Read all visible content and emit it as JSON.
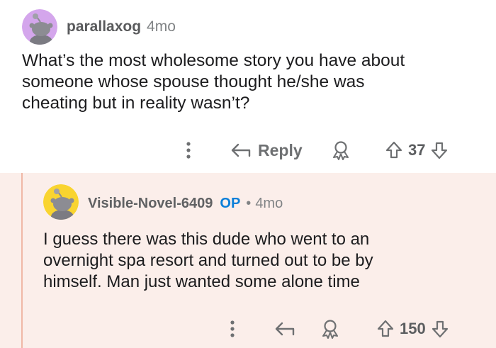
{
  "comments": [
    {
      "username": "parallaxog",
      "age": "4mo",
      "avatar_color": "#d4a6ec",
      "body_lines": [
        "What’s the most wholesome story you have about",
        "someone whose spouse thought he/she was",
        "cheating but in reality wasn’t?"
      ],
      "actions": {
        "reply_label": "Reply",
        "score": "37"
      }
    },
    {
      "username": "Visible-Novel-6409",
      "op_badge": "OP",
      "separator": "•",
      "age": "4mo",
      "avatar_color": "#f9d430",
      "body_lines": [
        "I guess there was this dude who went to an",
        "overnight spa resort and turned out to be by",
        "himself. Man just wanted some alone time"
      ],
      "actions": {
        "score": "150"
      }
    }
  ],
  "icons": [
    "more-options-icon",
    "reply-arrow-icon",
    "award-icon",
    "upvote-icon",
    "downvote-icon",
    "snoo-avatar-icon"
  ],
  "colors": {
    "reply_background": "#fbeeea",
    "thread_line": "#f0b8a6",
    "op_badge": "#0a7fd9"
  }
}
